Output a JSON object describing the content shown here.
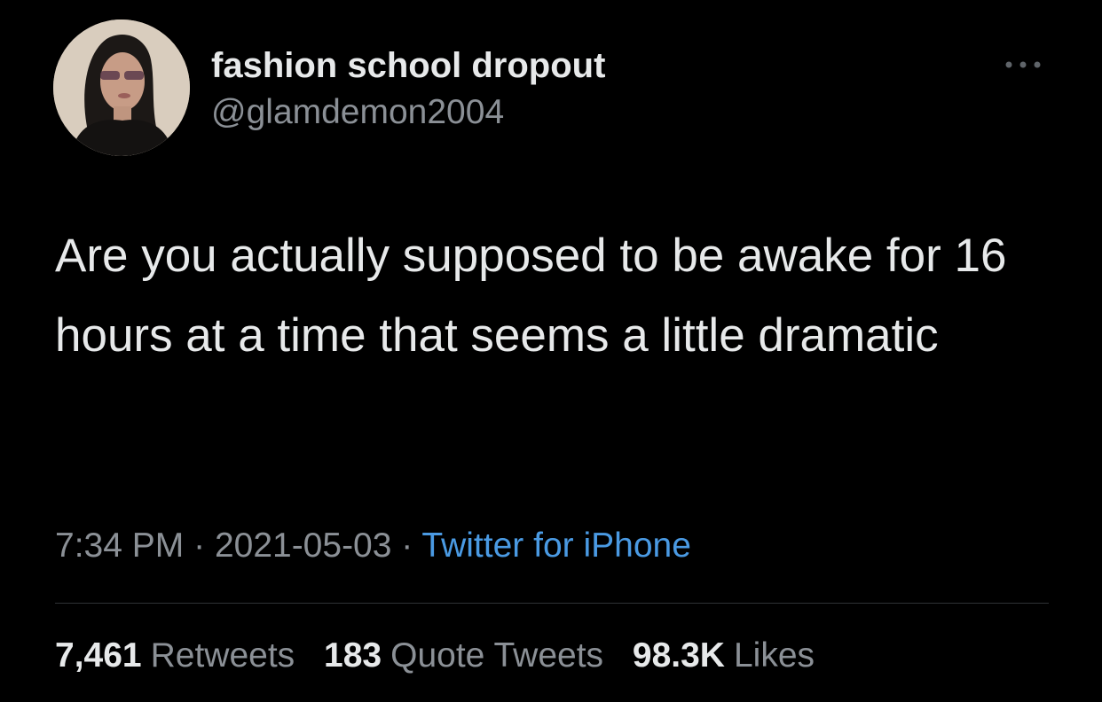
{
  "author": {
    "display_name": "fashion school dropout",
    "handle": "@glamdemon2004"
  },
  "more_icon": "more-horizontal-icon",
  "tweet": {
    "text": "Are you actually supposed to be awake for 16 hours at a time that seems a little dramatic"
  },
  "meta": {
    "time": "7:34 PM",
    "separator": "·",
    "date": "2021-05-03",
    "source": "Twitter for iPhone"
  },
  "stats": {
    "retweets": {
      "count": "7,461",
      "label": "Retweets"
    },
    "quotes": {
      "count": "183",
      "label": "Quote Tweets"
    },
    "likes": {
      "count": "98.3K",
      "label": "Likes"
    }
  },
  "colors": {
    "background": "#000000",
    "primary_text": "#e7e9ea",
    "secondary_text": "#8b9096",
    "link": "#4a9ae3",
    "divider": "#2f3336"
  }
}
